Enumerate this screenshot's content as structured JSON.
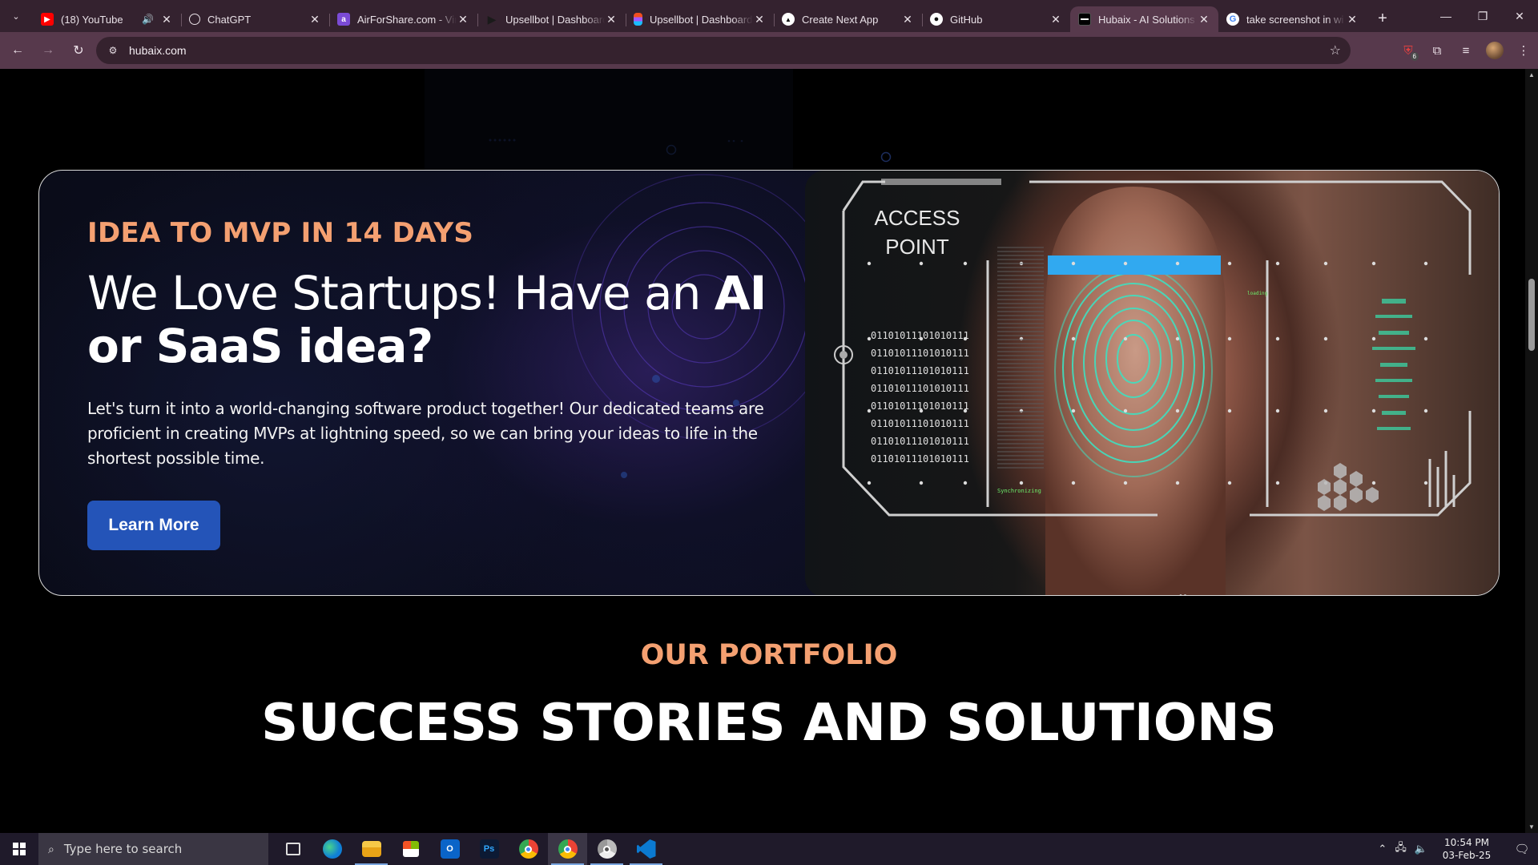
{
  "browser": {
    "tabs": [
      {
        "title": "(18) YouTube",
        "icon": "youtube-icon",
        "color": "#ff0000",
        "glyph": "▶",
        "audio": true
      },
      {
        "title": "ChatGPT",
        "icon": "chatgpt-icon",
        "color": "#34222f",
        "glyph": "⚙"
      },
      {
        "title": "AirForShare.com - Vir",
        "icon": "airforshare-icon",
        "color": "#7b4bd6",
        "glyph": "a"
      },
      {
        "title": "Upsellbot | Dashboard",
        "icon": "upsellbot-icon",
        "color": "#222",
        "glyph": "▶"
      },
      {
        "title": "Upsellbot | Dashboard",
        "icon": "figma-icon",
        "color": "#a259ff",
        "glyph": "F"
      },
      {
        "title": "Create Next App",
        "icon": "nextjs-icon",
        "color": "#111",
        "glyph": "▲"
      },
      {
        "title": "GitHub",
        "icon": "github-icon",
        "color": "#111",
        "glyph": "●"
      },
      {
        "title": "Hubaix - AI Solutions",
        "icon": "hubaix-icon",
        "color": "#111",
        "glyph": "━",
        "active": true
      },
      {
        "title": "take screenshot in wi",
        "icon": "google-icon",
        "color": "#fff",
        "glyph": "G"
      }
    ],
    "url": "hubaix.com",
    "extension_badge": "6"
  },
  "hero": {
    "eyebrow": "IDEA TO MVP IN 14 DAYS",
    "headline_regular": "We Love Startups! Have an ",
    "headline_bold": "AI or SaaS idea?",
    "description": "Let's turn it into a world-changing software product together! Our dedicated teams are proficient in creating MVPs at lightning speed, so we can bring your ideas to life in the shortest possible time.",
    "cta_label": "Learn More",
    "image_text": {
      "line1": "ACCESS",
      "line2": "POINT",
      "binary": "01101011101010111",
      "tag1": "Synchronizing",
      "tag2": "loading"
    }
  },
  "portfolio": {
    "kicker": "OUR PORTFOLIO",
    "title": "SUCCESS STORIES AND SOLUTIONS"
  },
  "taskbar": {
    "search_placeholder": "Type here to search",
    "time": "10:54 PM",
    "date": "03-Feb-25",
    "apps": [
      "task-view",
      "edge",
      "file-explorer",
      "microsoft-store",
      "outlook",
      "photoshop",
      "chrome",
      "chrome-profile",
      "chrome-alt",
      "vscode"
    ]
  },
  "colors": {
    "accent_orange": "#f4a071",
    "cta_blue": "#2454b8",
    "chrome_frame": "#34222f",
    "chrome_toolbar": "#57394c"
  }
}
